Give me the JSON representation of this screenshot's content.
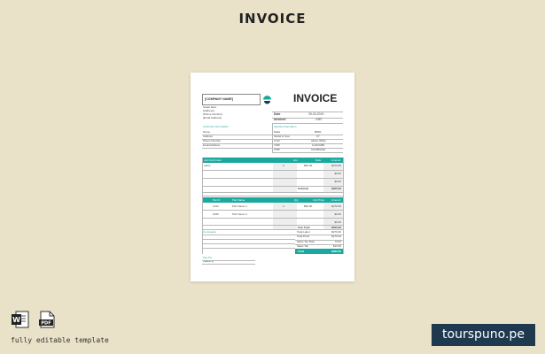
{
  "heading": "INVOICE",
  "invoice": {
    "company_name": "[COMPANY NAME]",
    "title": "INVOICE",
    "addr": [
      "Street Here",
      "[Address]",
      "[Phone Number]",
      "[Email Address]"
    ],
    "date_label": "Date",
    "date_value": "29-03-2019",
    "invoice_label": "Invoice#",
    "invoice_value": "2457",
    "customer_heading": "Customer Information",
    "customer_rows": [
      "Name",
      "Address",
      "Phone Number",
      "Email Address"
    ],
    "vehicle_heading": "Vehicle Information",
    "vehicle_rows": [
      {
        "label": "Make",
        "value": "BMW"
      },
      {
        "label": "Model & Year",
        "value": "X7"
      },
      {
        "label": "Color",
        "value": "Alpine White"
      },
      {
        "label": "VIN#",
        "value": "1HGCM82"
      },
      {
        "label": "VIP#",
        "value": "CHAIRMAN"
      }
    ],
    "job_headers": [
      "Job Performed",
      "Hrs",
      "Rate",
      "Amount"
    ],
    "job_rows": [
      {
        "desc": "Labor",
        "hrs": "3",
        "rate": "$90.00",
        "amount": "$270.00"
      },
      {
        "desc": "",
        "hrs": "",
        "rate": "",
        "amount": "$0.00"
      },
      {
        "desc": "",
        "hrs": "",
        "rate": "",
        "amount": "$0.00"
      }
    ],
    "job_subtotal_label": "Subtotal",
    "job_subtotal_value": "$300.00",
    "parts_headers": [
      "Part #",
      "Part Name",
      "Qty",
      "Unit Price",
      "Amount"
    ],
    "parts_rows": [
      {
        "num": "1234",
        "name": "Part Name 1",
        "qty": "3",
        "unit": "$90.00",
        "amount": "$270.00"
      },
      {
        "num": "2345",
        "name": "Part Name 2",
        "qty": "",
        "unit": "",
        "amount": "$0.00"
      },
      {
        "num": "",
        "name": "",
        "qty": "",
        "unit": "",
        "amount": "$0.00"
      }
    ],
    "parts_subtotal_label": "Sub Total",
    "parts_subtotal_value": "$300.00",
    "comments_heading": "Comments",
    "summary_rows": [
      {
        "label": "Total Labor",
        "value": "$270.00"
      },
      {
        "label": "Total Parts",
        "value": "$270.00"
      },
      {
        "label": "Sales Tax Rate",
        "value": "5.0%"
      },
      {
        "label": "Sales Tax",
        "value": "$13.50"
      }
    ],
    "total_label": "Total",
    "total_value": "$283.50",
    "pay_to_heading": "Pay Tol",
    "pay_to_value": "[Name 1]"
  },
  "footer": {
    "editable_text": "fully editable template",
    "word_label": "W",
    "pdf_label": "PDF",
    "brand": "tourspuno.pe"
  },
  "colors": {
    "accent": "#1aa99f",
    "background": "#e9e1c8",
    "brand_bg": "#1f3a4e"
  }
}
